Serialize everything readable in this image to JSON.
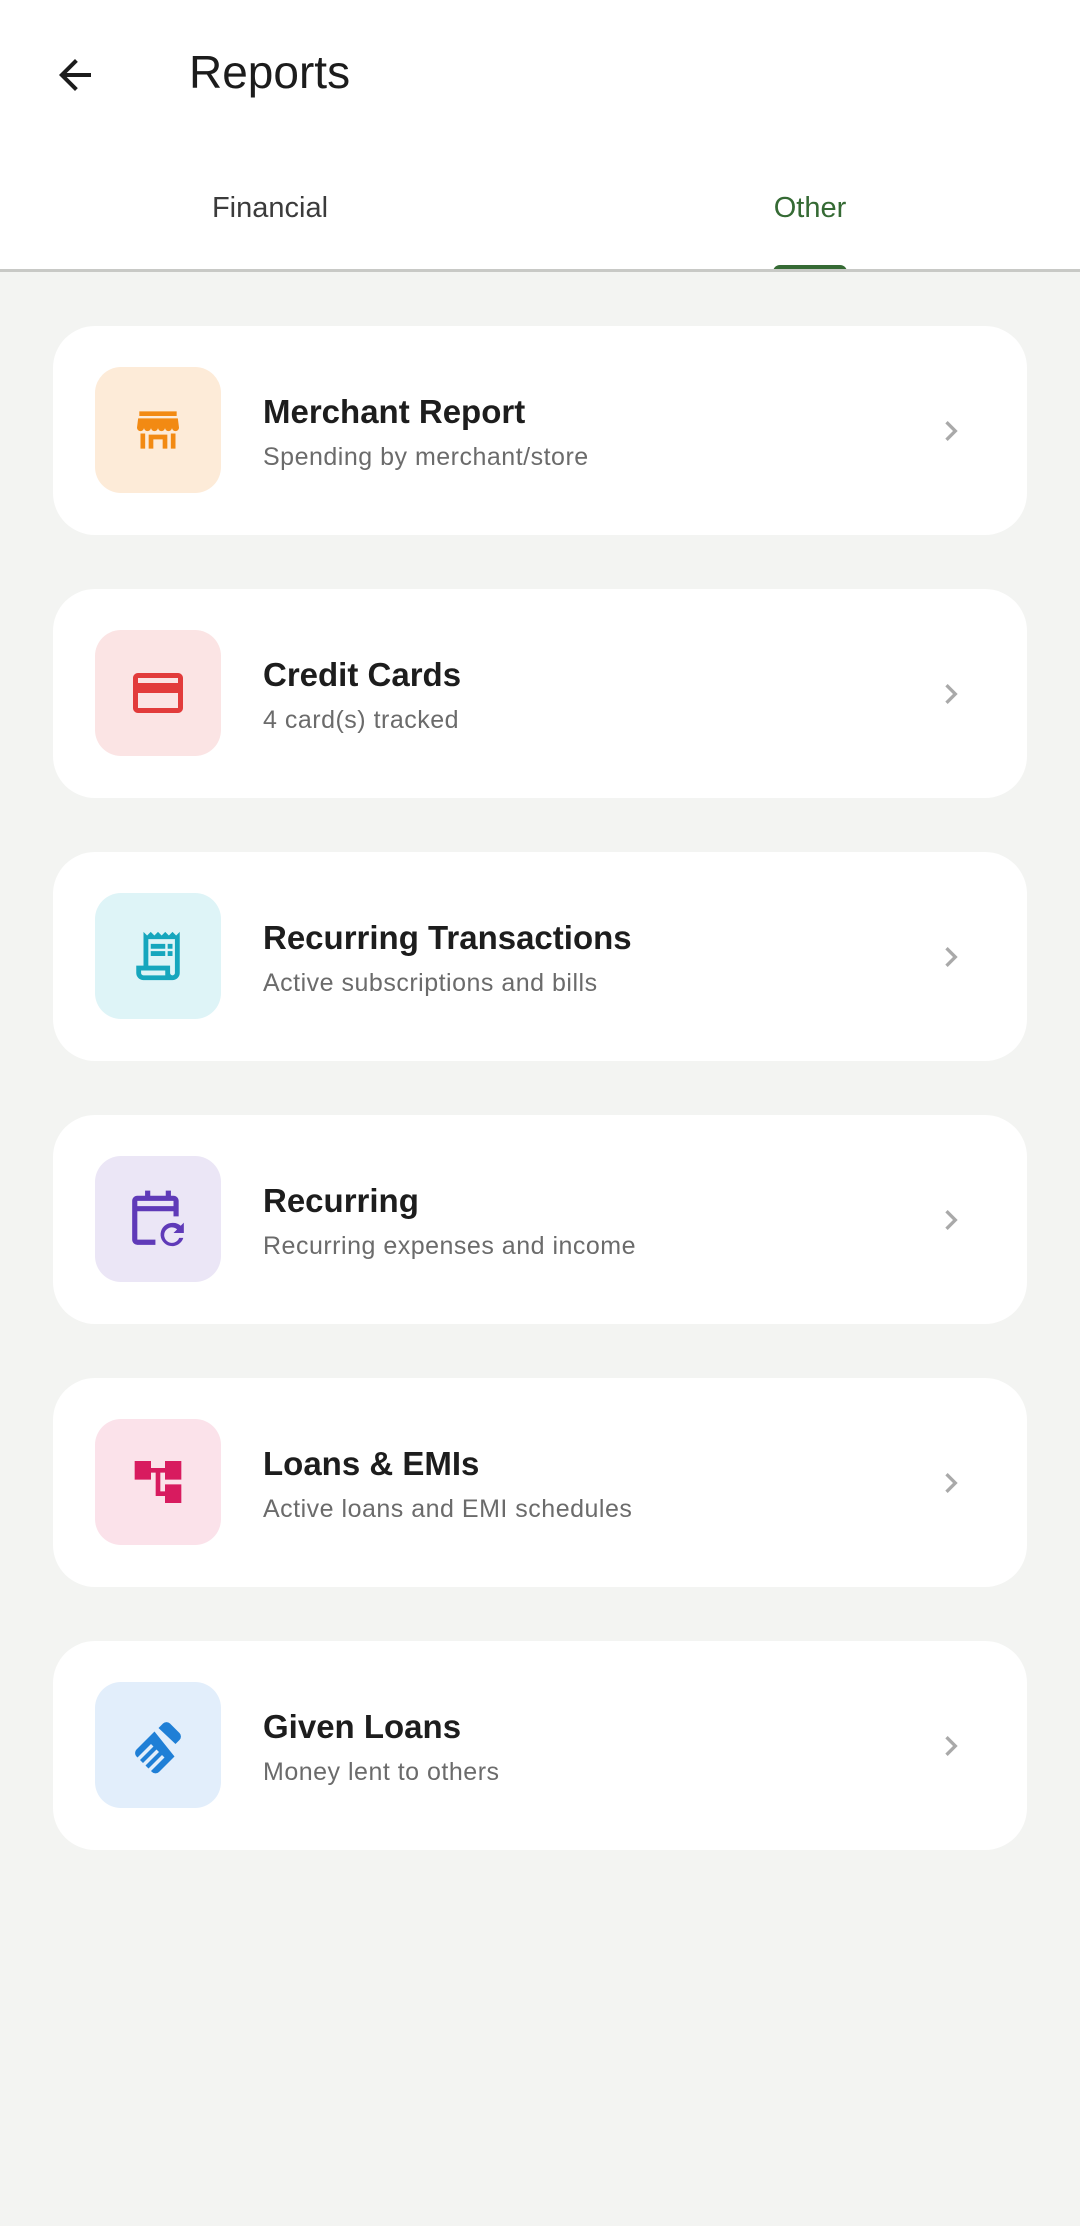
{
  "header": {
    "title": "Reports",
    "back_icon": "arrow-left-icon"
  },
  "tabs": [
    {
      "label": "Financial",
      "active": false
    },
    {
      "label": "Other",
      "active": true
    }
  ],
  "colors": {
    "accent": "#356a34",
    "background": "#f3f4f2",
    "card": "#ffffff",
    "chevron": "#a9a9a9"
  },
  "reports": [
    {
      "title": "Merchant Report",
      "subtitle": "Spending by merchant/store",
      "icon": "storefront-icon",
      "tile_color": "#fdebd8",
      "icon_color": "#f28a13"
    },
    {
      "title": "Credit Cards",
      "subtitle": "4 card(s) tracked",
      "icon": "credit-card-icon",
      "tile_color": "#fbe4e4",
      "icon_color": "#e23b3b"
    },
    {
      "title": "Recurring Transactions",
      "subtitle": "Active subscriptions and bills",
      "icon": "receipt-icon",
      "tile_color": "#def4f7",
      "icon_color": "#16a6bd"
    },
    {
      "title": "Recurring",
      "subtitle": "Recurring expenses and income",
      "icon": "calendar-repeat-icon",
      "tile_color": "#ebe6f6",
      "icon_color": "#5f3ab8"
    },
    {
      "title": "Loans & EMIs",
      "subtitle": "Active loans and EMI schedules",
      "icon": "account-tree-icon",
      "tile_color": "#fbe2ea",
      "icon_color": "#d81b5f"
    },
    {
      "title": "Given Loans",
      "subtitle": "Money lent to others",
      "icon": "handshake-icon",
      "tile_color": "#e2eefb",
      "icon_color": "#1f7fd6"
    }
  ]
}
